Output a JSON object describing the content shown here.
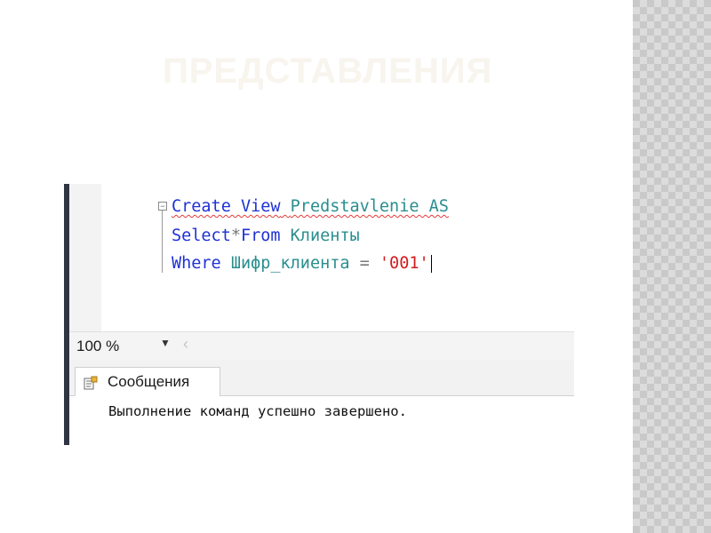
{
  "slide": {
    "title": "ПРЕДСТАВЛЕНИЯ"
  },
  "editor": {
    "lines": [
      {
        "parts": [
          "Create View",
          " ",
          "Predstavlenie AS"
        ]
      },
      {
        "parts": [
          "Select",
          "*",
          "From",
          " ",
          "Клиенты"
        ]
      },
      {
        "parts": [
          "Where",
          " ",
          "Шифр_клиента",
          " = ",
          "'001'"
        ]
      }
    ]
  },
  "toolbar": {
    "zoom": "100 %"
  },
  "results": {
    "tab_label": "Сообщения",
    "message": "Выполнение команд успешно завершено."
  },
  "colors": {
    "keyword": "#1f32d6",
    "identifier": "#2a8e8e",
    "string": "#d21d1d",
    "change_bar": "#f1e55e"
  }
}
